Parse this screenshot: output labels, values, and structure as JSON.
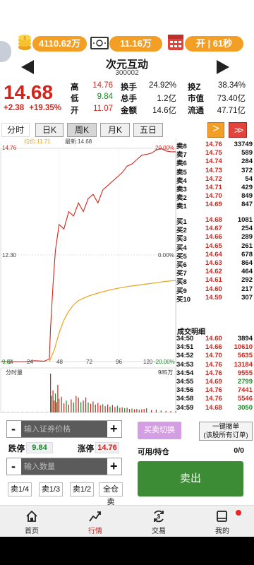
{
  "header": {
    "balance": "4110.62万",
    "cash": "11.16万",
    "session": "开 | 61秒",
    "stock_name": "次元互动",
    "stock_code": "300002"
  },
  "quote": {
    "price": "14.68",
    "change": "+2.38",
    "change_pct": "+19.35%",
    "rows": [
      {
        "l1": "高",
        "v1": "14.76",
        "c1": "red",
        "l2": "换手",
        "v2": "24.92%",
        "l3": "换Z",
        "v3": "38.34%"
      },
      {
        "l1": "低",
        "v1": "9.84",
        "c1": "green",
        "l2": "总手",
        "v2": "1.2亿",
        "l3": "市值",
        "v3": "73.40亿"
      },
      {
        "l1": "开",
        "v1": "11.07",
        "c1": "red",
        "l2": "金额",
        "v2": "14.6亿",
        "l3": "流通",
        "v3": "47.71亿"
      }
    ]
  },
  "tabs": [
    "分时",
    "日K",
    "周K",
    "月K",
    "五日"
  ],
  "tab_buttons": {
    "next": ">",
    "last": ">>"
  },
  "chart": {
    "avg_price": "均价:11.71",
    "latest": "最新:14.68",
    "top_price": "14.76",
    "top_pct": "20.00%",
    "mid_price": "12.30",
    "mid_pct": "0.00%",
    "bottom_price": "9.84",
    "bottom_pct": "-20.00%",
    "x_ticks": [
      "0",
      "24",
      "48",
      "72",
      "96",
      "120"
    ],
    "volume_label": "分时量",
    "volume_max": "985万"
  },
  "chart_data": {
    "type": "line",
    "title": "",
    "xlabel": "",
    "ylabel": "",
    "xlim": [
      0,
      120
    ],
    "ylim": [
      9.84,
      14.76
    ],
    "series": [
      {
        "name": "price",
        "x": [
          0,
          10,
          20,
          28,
          36,
          40,
          41,
          43,
          45,
          48,
          52,
          56,
          60,
          64,
          68,
          72,
          76,
          80,
          84,
          88,
          92,
          96,
          100,
          104,
          108,
          112,
          116,
          120,
          124,
          128,
          132,
          136,
          140,
          144
        ],
        "values": [
          9.84,
          9.84,
          9.84,
          9.86,
          9.85,
          9.9,
          10.6,
          11.6,
          12.4,
          13.0,
          12.9,
          13.3,
          13.2,
          13.5,
          13.3,
          13.6,
          13.7,
          13.5,
          13.8,
          13.9,
          14.0,
          14.1,
          14.2,
          14.35,
          14.4,
          14.5,
          14.6,
          14.62,
          14.65,
          14.72,
          14.76,
          14.7,
          14.68,
          14.68
        ]
      },
      {
        "name": "average",
        "x": [
          40,
          44,
          48,
          52,
          56,
          60,
          64,
          72,
          80,
          88,
          96,
          104,
          112,
          120,
          128,
          136,
          144
        ],
        "values": [
          9.84,
          10.1,
          10.5,
          10.8,
          11.0,
          11.15,
          11.25,
          11.35,
          11.42,
          11.48,
          11.53,
          11.57,
          11.6,
          11.63,
          11.66,
          11.69,
          11.71
        ]
      }
    ],
    "volume": {
      "x": [
        2,
        6,
        10,
        14,
        18,
        22,
        26,
        30,
        34,
        38,
        41,
        42,
        43,
        44,
        45,
        46,
        47,
        48,
        50,
        52,
        54,
        56,
        58,
        60,
        62,
        64,
        66,
        68,
        70,
        72,
        74,
        76,
        78,
        80,
        82,
        84,
        86,
        88,
        90,
        92,
        94,
        96,
        98,
        100,
        102,
        104,
        106,
        108,
        110,
        112,
        114,
        116,
        118,
        120,
        124,
        128,
        132,
        136,
        140,
        144
      ],
      "values": [
        5,
        4,
        3,
        3,
        2,
        3,
        2,
        4,
        3,
        6,
        985,
        420,
        560,
        300,
        480,
        260,
        700,
        350,
        400,
        230,
        300,
        200,
        330,
        250,
        420,
        380,
        260,
        300,
        380,
        250,
        220,
        280,
        200,
        240,
        180,
        210,
        160,
        200,
        150,
        190,
        140,
        170,
        120,
        130,
        110,
        120,
        90,
        100,
        80,
        90,
        70,
        80,
        90,
        110,
        60,
        70,
        50,
        40,
        35,
        30
      ]
    }
  },
  "order_book": {
    "sell": [
      {
        "label": "卖8",
        "price": "14.76",
        "vol": "33749"
      },
      {
        "label": "卖7",
        "price": "14.75",
        "vol": "589"
      },
      {
        "label": "卖6",
        "price": "14.74",
        "vol": "284"
      },
      {
        "label": "卖5",
        "price": "14.73",
        "vol": "372"
      },
      {
        "label": "卖4",
        "price": "14.72",
        "vol": "54"
      },
      {
        "label": "卖3",
        "price": "14.71",
        "vol": "429"
      },
      {
        "label": "卖2",
        "price": "14.70",
        "vol": "849"
      },
      {
        "label": "卖1",
        "price": "14.69",
        "vol": "847"
      }
    ],
    "buy": [
      {
        "label": "买1",
        "price": "14.68",
        "vol": "1081"
      },
      {
        "label": "买2",
        "price": "14.67",
        "vol": "254"
      },
      {
        "label": "买3",
        "price": "14.66",
        "vol": "289"
      },
      {
        "label": "买4",
        "price": "14.65",
        "vol": "261"
      },
      {
        "label": "买5",
        "price": "14.64",
        "vol": "678"
      },
      {
        "label": "买6",
        "price": "14.63",
        "vol": "864"
      },
      {
        "label": "买7",
        "price": "14.62",
        "vol": "464"
      },
      {
        "label": "买8",
        "price": "14.61",
        "vol": "292"
      },
      {
        "label": "买9",
        "price": "14.60",
        "vol": "217"
      },
      {
        "label": "买10",
        "price": "14.59",
        "vol": "307"
      }
    ]
  },
  "trades": {
    "title": "成交明细",
    "rows": [
      {
        "time": "34:50",
        "price": "14.60",
        "vol": "3894"
      },
      {
        "time": "34:51",
        "price": "14.66",
        "vol": "10610"
      },
      {
        "time": "34:52",
        "price": "14.70",
        "vol": "5635"
      },
      {
        "time": "34:53",
        "price": "14.76",
        "vol": "13184"
      },
      {
        "time": "34:54",
        "price": "14.76",
        "vol": "9555"
      },
      {
        "time": "34:55",
        "price": "14.69",
        "vol": "2799"
      },
      {
        "time": "34:56",
        "price": "14.76",
        "vol": "7441"
      },
      {
        "time": "34:58",
        "price": "14.76",
        "vol": "5546"
      },
      {
        "time": "34:59",
        "price": "14.68",
        "vol": "3050"
      }
    ]
  },
  "trade_panel": {
    "price_placeholder": "输入证券价格",
    "qty_placeholder": "输入数量",
    "limit_down_label": "跌停",
    "limit_down": "9.84",
    "limit_up_label": "涨停",
    "limit_up": "14.76",
    "minus": "-",
    "plus": "+",
    "fractions": [
      "卖1/4",
      "卖1/3",
      "卖1/2",
      "全仓卖"
    ],
    "switch": "买卖切换",
    "cancel_line1": "一键撤单",
    "cancel_line2": "(该股所有订单)",
    "avail_label": "可用/持仓",
    "avail_value": "0/0",
    "sell": "卖出"
  },
  "nav": [
    {
      "label": "首页",
      "icon": "home-icon"
    },
    {
      "label": "行情",
      "icon": "trend-icon"
    },
    {
      "label": "交易",
      "icon": "exchange-icon"
    },
    {
      "label": "我的",
      "icon": "book-icon"
    }
  ],
  "colors": {
    "up": "#d2241c",
    "down": "#1a8a26",
    "accent": "#f39e24",
    "avg_line": "#e6a417"
  }
}
